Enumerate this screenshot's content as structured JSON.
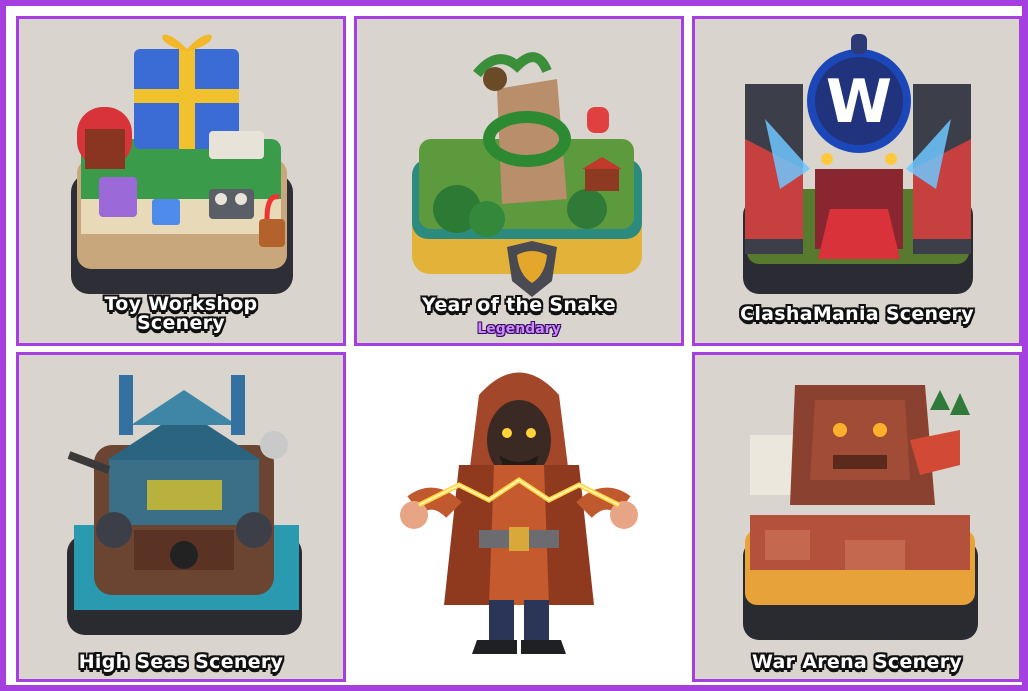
{
  "colors": {
    "frame": "#a63fe0",
    "card_bg": "#d9d4cd",
    "legendary": "#c98cff"
  },
  "cards": {
    "toy_workshop": {
      "title_line1": "Toy Workshop",
      "title_line2": "Scenery"
    },
    "year_of_snake": {
      "title": "Year of the Snake",
      "rarity": "Legendary"
    },
    "clashamania": {
      "title": "ClashaMania Scenery",
      "logo_letter": "W"
    },
    "high_seas": {
      "title": "High Seas Scenery"
    },
    "wizard": {
      "icon": "electro-wizard-character"
    },
    "war_arena": {
      "title": "War Arena Scenery"
    }
  }
}
